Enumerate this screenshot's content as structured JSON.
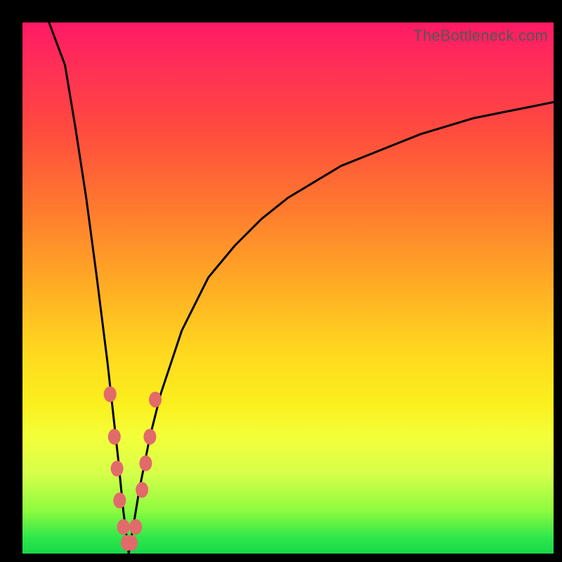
{
  "watermark": "TheBottleneck.com",
  "chart_data": {
    "type": "line",
    "title": "",
    "xlabel": "",
    "ylabel": "",
    "xlim": [
      0,
      100
    ],
    "ylim": [
      0,
      100
    ],
    "grid": false,
    "legend": false,
    "note": "Black curve is |1 - k/x|-style bottleneck mismatch; y is percent mismatch (0 at bottom = ideal, 100 at top). Minimum near x≈20. Red markers cluster around the minimum.",
    "series": [
      {
        "name": "bottleneck-curve",
        "x": [
          5,
          8,
          10,
          12,
          14,
          16,
          18,
          19,
          20,
          21,
          22,
          24,
          26,
          30,
          35,
          40,
          45,
          50,
          55,
          60,
          65,
          70,
          75,
          80,
          85,
          90,
          95,
          100
        ],
        "y": [
          100,
          92,
          80,
          67,
          52,
          36,
          18,
          8,
          0,
          6,
          12,
          22,
          30,
          42,
          52,
          58,
          63,
          67,
          70,
          73,
          75,
          77,
          79,
          80.5,
          82,
          83,
          84,
          85
        ]
      }
    ],
    "markers": {
      "name": "sample-points",
      "points": [
        {
          "x": 16.5,
          "y": 30
        },
        {
          "x": 17.3,
          "y": 22
        },
        {
          "x": 17.8,
          "y": 16
        },
        {
          "x": 18.3,
          "y": 10
        },
        {
          "x": 19.0,
          "y": 5
        },
        {
          "x": 19.7,
          "y": 2
        },
        {
          "x": 20.5,
          "y": 2
        },
        {
          "x": 21.3,
          "y": 5
        },
        {
          "x": 22.5,
          "y": 12
        },
        {
          "x": 23.2,
          "y": 17
        },
        {
          "x": 24.0,
          "y": 22
        },
        {
          "x": 25.0,
          "y": 29
        }
      ],
      "color": "#e26a6a",
      "radius_px": 9
    }
  }
}
